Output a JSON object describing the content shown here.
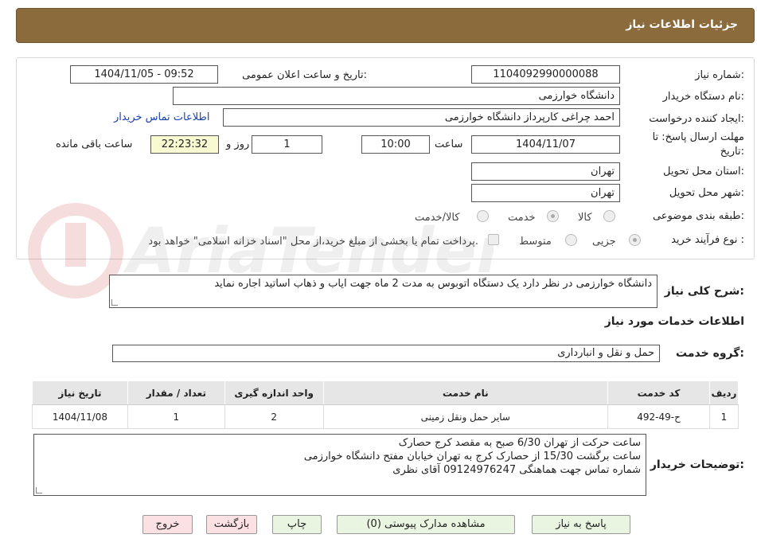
{
  "header": {
    "title": "جزئیات اطلاعات نیاز"
  },
  "form": {
    "need_number_label": "شماره نیاز:",
    "need_number": "1104092990000088",
    "announce_label": "تاریخ و ساعت اعلان عمومی:",
    "announce_value": "1404/11/05 - 09:52",
    "buyer_org_label": "نام دستگاه خریدار:",
    "buyer_org": "دانشگاه خوارزمی",
    "creator_label": "ایجاد کننده درخواست:",
    "creator": "احمد چراغی کارپرداز  دانشگاه خوارزمی",
    "contact_link": "اطلاعات تماس خریدار",
    "deadline_label_1": "مهلت ارسال پاسخ: تا",
    "deadline_label_2": "تاریخ:",
    "deadline_date": "1404/11/07",
    "time_label": "ساعت",
    "deadline_time": "10:00",
    "days": "1",
    "days_label": "روز و",
    "remaining_time": "22:23:32",
    "remaining_label": "ساعت باقی مانده",
    "province_label": "استان محل تحویل:",
    "province": "تهران",
    "city_label": "شهر محل تحویل:",
    "city": "تهران",
    "category_label": "طبقه بندی موضوعی:",
    "category_options": [
      "کالا",
      "خدمت",
      "کالا/خدمت"
    ],
    "category_selected": "خدمت",
    "process_label": "نوع فرآیند خرید :",
    "process_options": [
      "جزیی",
      "متوسط"
    ],
    "process_selected": "جزیی",
    "treasury_note": "پرداخت تمام یا بخشی از مبلغ خرید،از محل \"اسناد خزانه اسلامی\" خواهد بود."
  },
  "description": {
    "label": "شرح کلی نیاز:",
    "text": "دانشگاه خوارزمی در نظر دارد یک دستگاه اتوبوس به مدت 2 ماه جهت ایاب و ذهاب اساتید اجاره نماید"
  },
  "services": {
    "section_title": "اطلاعات خدمات مورد نیاز",
    "group_label": "گروه خدمت:",
    "group_value": "حمل و نقل و انبارداری",
    "columns": [
      "ردیف",
      "کد خدمت",
      "نام خدمت",
      "واحد اندازه گیری",
      "تعداد / مقدار",
      "تاریخ نیاز"
    ],
    "rows": [
      {
        "row": "1",
        "code": "ح-49-492",
        "name": "سایر حمل ونقل زمینی",
        "unit": "2",
        "qty": "1",
        "date": "1404/11/08"
      }
    ]
  },
  "buyer_notes": {
    "label": "توضیحات خریدار:",
    "line1": "ساعت حرکت از تهران 6/30 صبح به مقصد کرج حصارک",
    "line2": "ساعت برگشت 15/30 از حصارک کرج به تهران خیابان مفتح دانشگاه خوارزمی",
    "line3": " شماره تماس جهت هماهنگی 09124976247  آقای نظری"
  },
  "buttons": {
    "reply": "پاسخ به نیاز",
    "docs": "مشاهده مدارک پیوستی (0)",
    "print": "چاپ",
    "back": "بازگشت",
    "exit": "خروج"
  },
  "watermark": {
    "text": "AriaTender.neT"
  },
  "colors": {
    "header_bg": "#8b6a3c",
    "link": "#1a3fb0",
    "button_green": "#e9f5e0",
    "button_pink": "#fbe0e4",
    "timer_bg": "#fafad2"
  }
}
